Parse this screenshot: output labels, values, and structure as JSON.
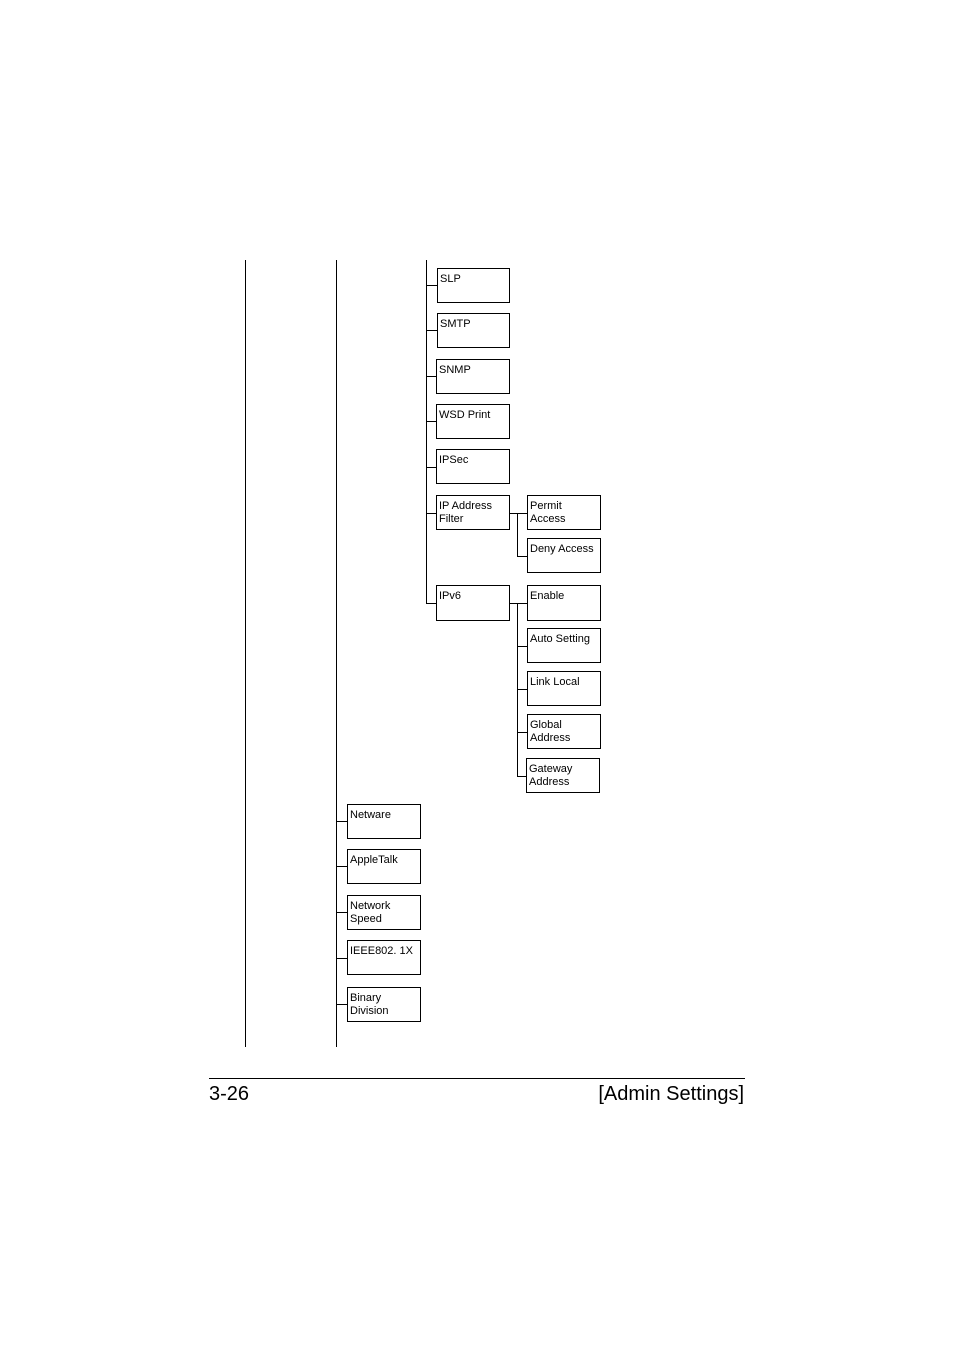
{
  "menu_tree": {
    "level3_items": [
      {
        "label": "SLP"
      },
      {
        "label": "SMTP"
      },
      {
        "label": "SNMP"
      },
      {
        "label": "WSD Print"
      },
      {
        "label": "IPSec"
      },
      {
        "label": "IP Address\nFilter",
        "children": [
          {
            "label": "Permit\nAccess"
          },
          {
            "label": "Deny Access"
          }
        ]
      },
      {
        "label": "IPv6",
        "children": [
          {
            "label": "Enable"
          },
          {
            "label": "Auto Setting"
          },
          {
            "label": "Link Local"
          },
          {
            "label": "Global\nAddress"
          },
          {
            "label": "Gateway\nAddress"
          }
        ]
      }
    ],
    "level2_items": [
      {
        "label": "Netware"
      },
      {
        "label": "AppleTalk"
      },
      {
        "label": "Network\nSpeed"
      },
      {
        "label": "IEEE802. 1X"
      },
      {
        "label": "Binary\nDivision"
      }
    ]
  },
  "footer": {
    "page_number": "3-26",
    "section_title": "[Admin Settings]"
  }
}
